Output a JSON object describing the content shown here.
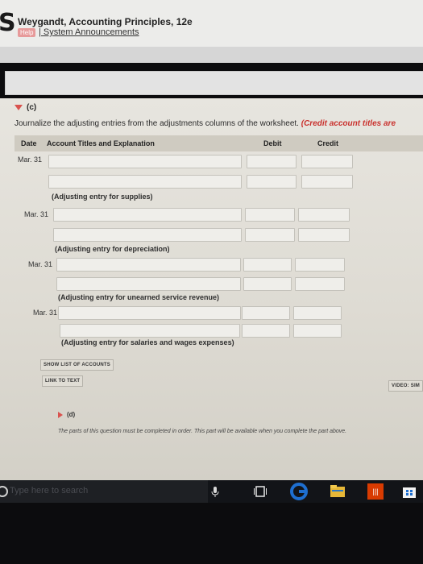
{
  "header": {
    "logo_letter": "S",
    "book_title": "Weygandt, Accounting Principles, 12e",
    "help_label": "Help",
    "announcements_link": "| System Announcements"
  },
  "part_c": {
    "label": "(c)",
    "instruction": "Journalize the adjusting entries from the adjustments columns of the worksheet.",
    "instruction_note": "(Credit account titles are",
    "columns": {
      "date": "Date",
      "account": "Account Titles and Explanation",
      "debit": "Debit",
      "credit": "Credit"
    },
    "entries": [
      {
        "date": "Mar. 31",
        "note": "(Adjusting entry for supplies)"
      },
      {
        "date": "Mar. 31",
        "note": "(Adjusting entry for depreciation)"
      },
      {
        "date": "Mar. 31",
        "note": "(Adjusting entry for unearned service revenue)"
      },
      {
        "date": "Mar. 31",
        "note": "(Adjusting entry for salaries and wages expenses)"
      }
    ],
    "show_accounts_button": "SHOW LIST OF ACCOUNTS",
    "link_to_text_button": "LINK TO TEXT",
    "video_button": "VIDEO: SIM"
  },
  "part_d": {
    "label": "(d)",
    "text": "The parts of this question must be completed in order. This part will be available when you complete the part above."
  },
  "taskbar": {
    "search_placeholder": "Type here to search"
  },
  "colors": {
    "accent_red": "#d9534f",
    "edge_blue": "#1e6fd0",
    "office_red": "#d83b01"
  }
}
